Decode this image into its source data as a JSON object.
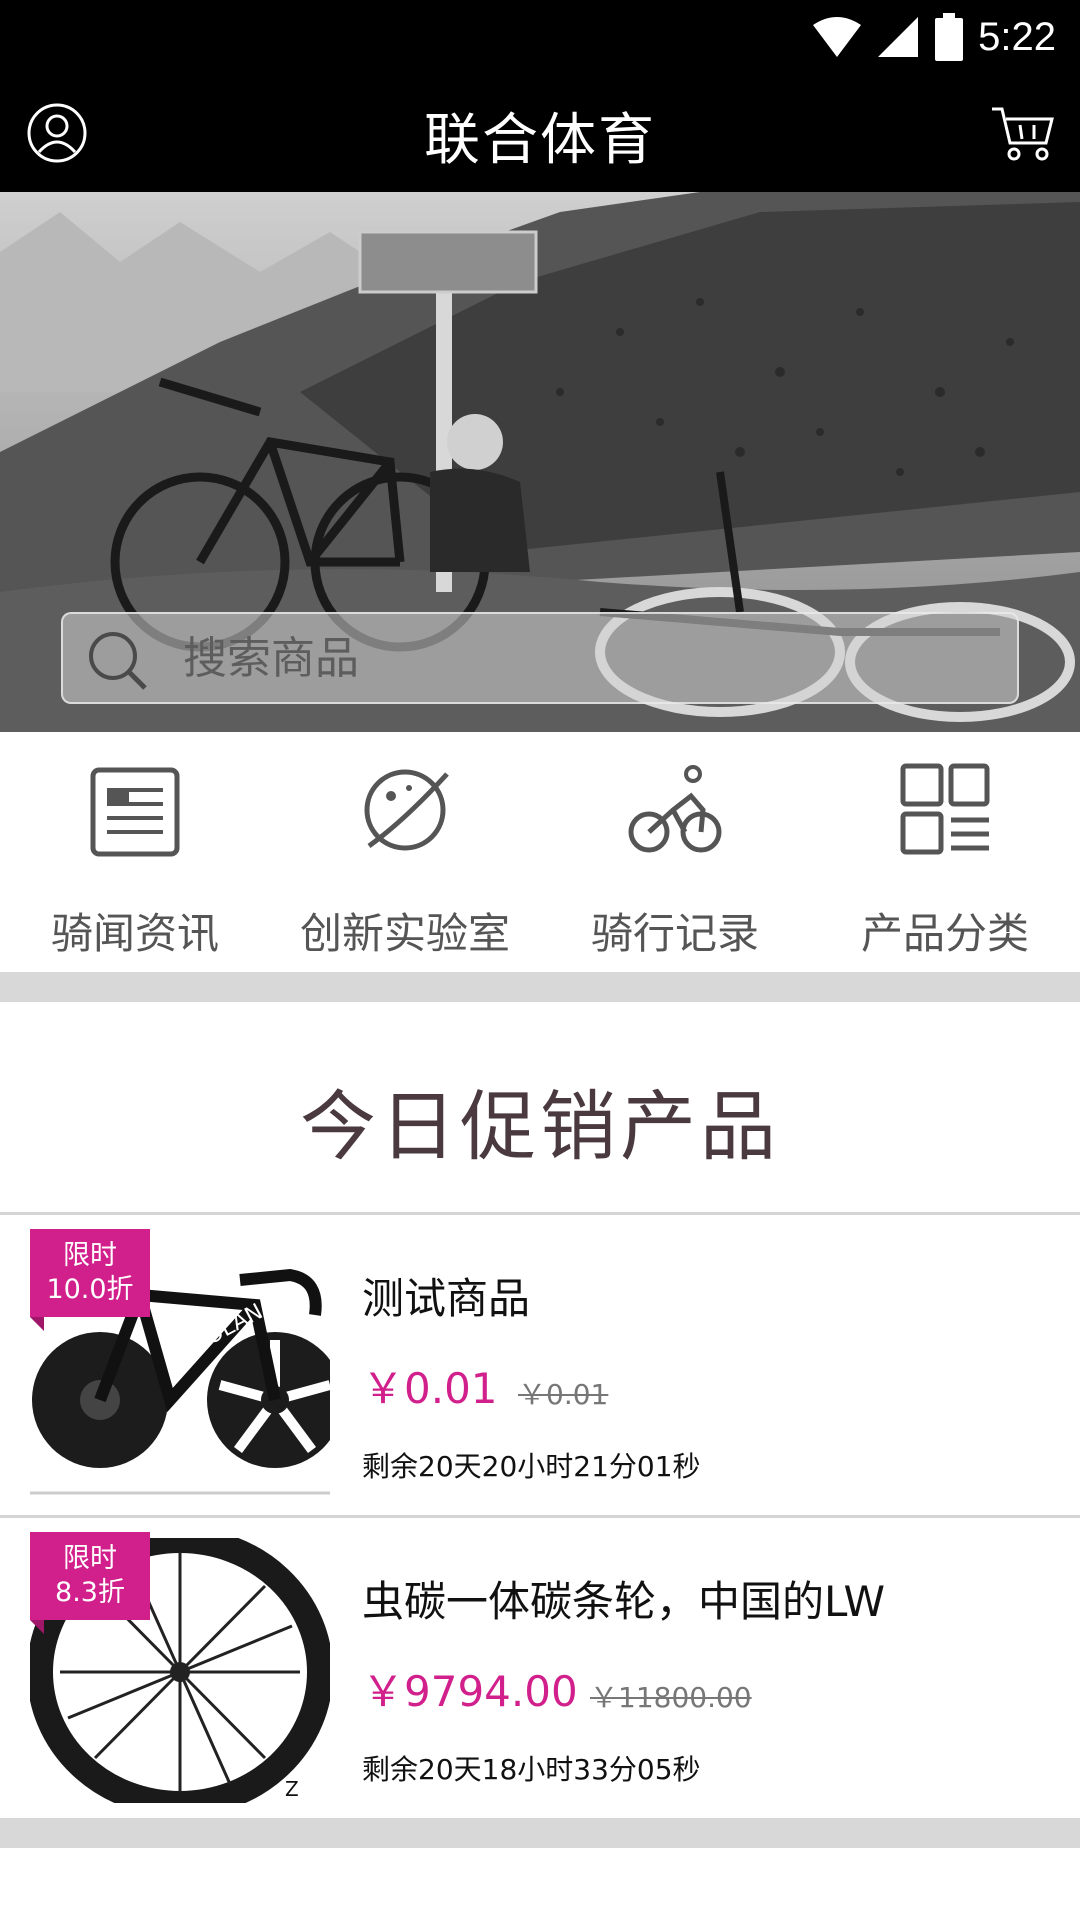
{
  "status_bar": {
    "time": "5:22"
  },
  "header": {
    "title": "联合体育"
  },
  "search": {
    "placeholder": "搜索商品"
  },
  "quick_nav": [
    {
      "label": "骑闻资讯",
      "icon": "document-icon"
    },
    {
      "label": "创新实验室",
      "icon": "planet-icon"
    },
    {
      "label": "骑行记录",
      "icon": "cyclist-icon"
    },
    {
      "label": "产品分类",
      "icon": "grid-list-icon"
    }
  ],
  "promo": {
    "title": "今日促销产品",
    "products": [
      {
        "badge_line1": "限时",
        "badge_line2": "10.0折",
        "name": "测试商品",
        "price": "￥0.01",
        "original_price": "￥0.01",
        "countdown": "剩余20天20小时21分01秒"
      },
      {
        "badge_line1": "限时",
        "badge_line2": "8.3折",
        "name": "虫碳一体碳条轮，中国的LW",
        "price": "￥9794.00",
        "original_price": "￥11800.00",
        "countdown": "剩余20天18小时33分05秒"
      }
    ]
  },
  "colors": {
    "accent": "#d11f8b",
    "title": "#4a3a40",
    "header_bg": "#000000"
  }
}
